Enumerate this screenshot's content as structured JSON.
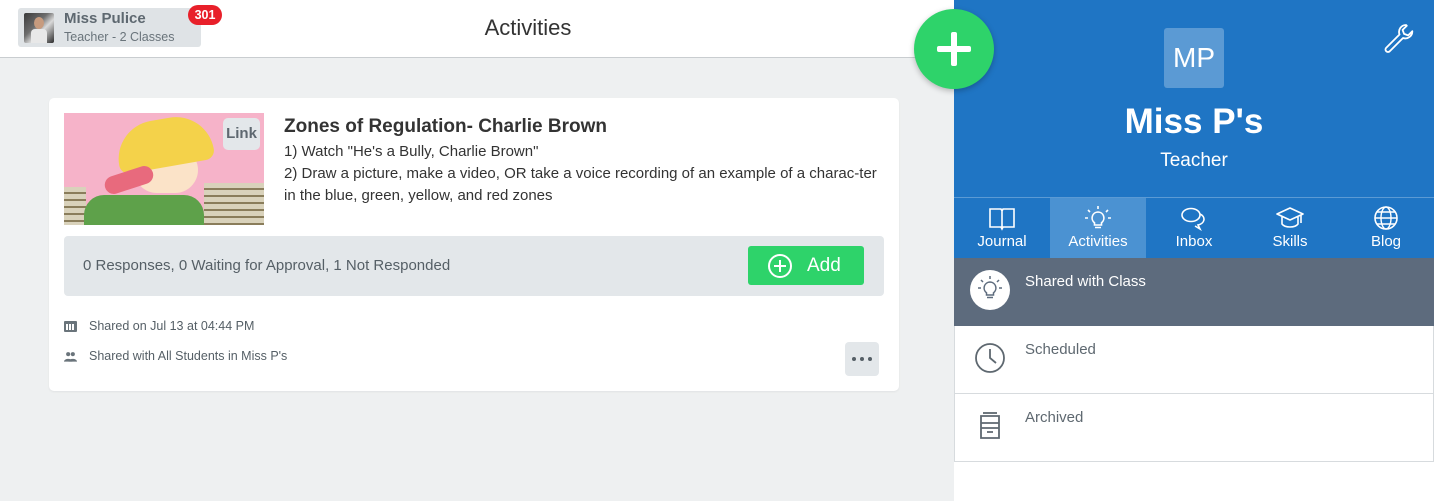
{
  "header": {
    "user_name": "Miss Pulice",
    "user_role": "Teacher - 2 Classes",
    "notification_count": "301",
    "title": "Activities"
  },
  "activity": {
    "thumb_badge": "Link",
    "title": "Zones of Regulation- Charlie Brown",
    "line1": "1) Watch \"He's a Bully, Charlie Brown\"",
    "line2": "2) Draw a picture, make a video, OR take a voice recording of an example of a charac-ter in the blue, green, yellow, and red zones",
    "responses": "0 Responses, 0 Waiting for Approval, 1 Not Responded",
    "add_label": "Add",
    "shared_on": "Shared on Jul 13 at 04:44 PM",
    "shared_with": "Shared with All Students in Miss P's"
  },
  "profile": {
    "initials": "MP",
    "name": "Miss P's",
    "role": "Teacher"
  },
  "nav": [
    {
      "label": "Journal",
      "icon": "book-icon"
    },
    {
      "label": "Activities",
      "icon": "lightbulb-icon",
      "active": true
    },
    {
      "label": "Inbox",
      "icon": "chat-bubbles-icon"
    },
    {
      "label": "Skills",
      "icon": "graduation-cap-icon"
    },
    {
      "label": "Blog",
      "icon": "globe-icon"
    }
  ],
  "filters": [
    {
      "label": "Shared with Class",
      "icon": "lightbulb-icon",
      "active": true
    },
    {
      "label": "Scheduled",
      "icon": "clock-icon"
    },
    {
      "label": "Archived",
      "icon": "archive-box-icon"
    }
  ],
  "colors": {
    "brand_blue": "#1f75c4",
    "green": "#2ed36a",
    "badge_red": "#e8202a",
    "active_filter": "#5d6b7d"
  }
}
